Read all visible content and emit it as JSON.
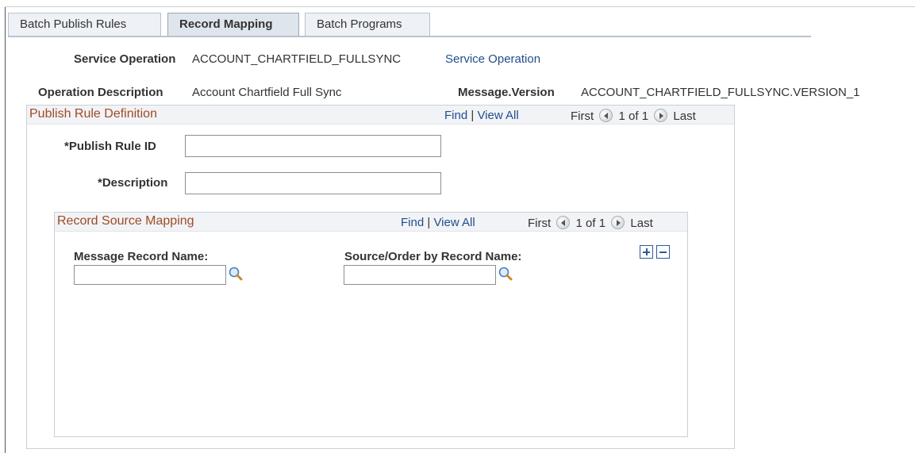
{
  "tabs": [
    {
      "label": "Batch Publish Rules",
      "active": false
    },
    {
      "label": "Record Mapping",
      "active": true
    },
    {
      "label": "Batch Programs",
      "active": false
    }
  ],
  "header": {
    "service_operation_label": "Service Operation",
    "service_operation_value": "ACCOUNT_CHARTFIELD_FULLSYNC",
    "service_operation_link": "Service Operation",
    "operation_description_label": "Operation Description",
    "operation_description_value": "Account Chartfield Full Sync",
    "message_version_label": "Message.Version",
    "message_version_value": "ACCOUNT_CHARTFIELD_FULLSYNC.VERSION_1"
  },
  "publish_rule_grid": {
    "title": "Publish Rule Definition",
    "find": "Find",
    "sep": "|",
    "view_all": "View All",
    "first": "First",
    "count": "1 of 1",
    "last": "Last",
    "publish_rule_id_label": "*Publish Rule ID",
    "publish_rule_id_value": "",
    "description_label": "*Description",
    "description_value": ""
  },
  "record_source_grid": {
    "title": "Record Source Mapping",
    "find": "Find",
    "sep": "|",
    "view_all": "View All",
    "first": "First",
    "count": "1 of 1",
    "last": "Last",
    "message_record_label": "Message Record Name:",
    "message_record_value": "",
    "source_order_label": "Source/Order by Record Name:",
    "source_order_value": ""
  },
  "icons": {
    "lookup": "magnifier-icon",
    "prev": "previous-arrow-icon",
    "next": "next-arrow-icon",
    "add": "add-row-icon",
    "delete": "delete-row-icon"
  },
  "colors": {
    "grid_title": "#a04a24",
    "link": "#1f4d8c",
    "tab_active": "#dfe5ec"
  }
}
